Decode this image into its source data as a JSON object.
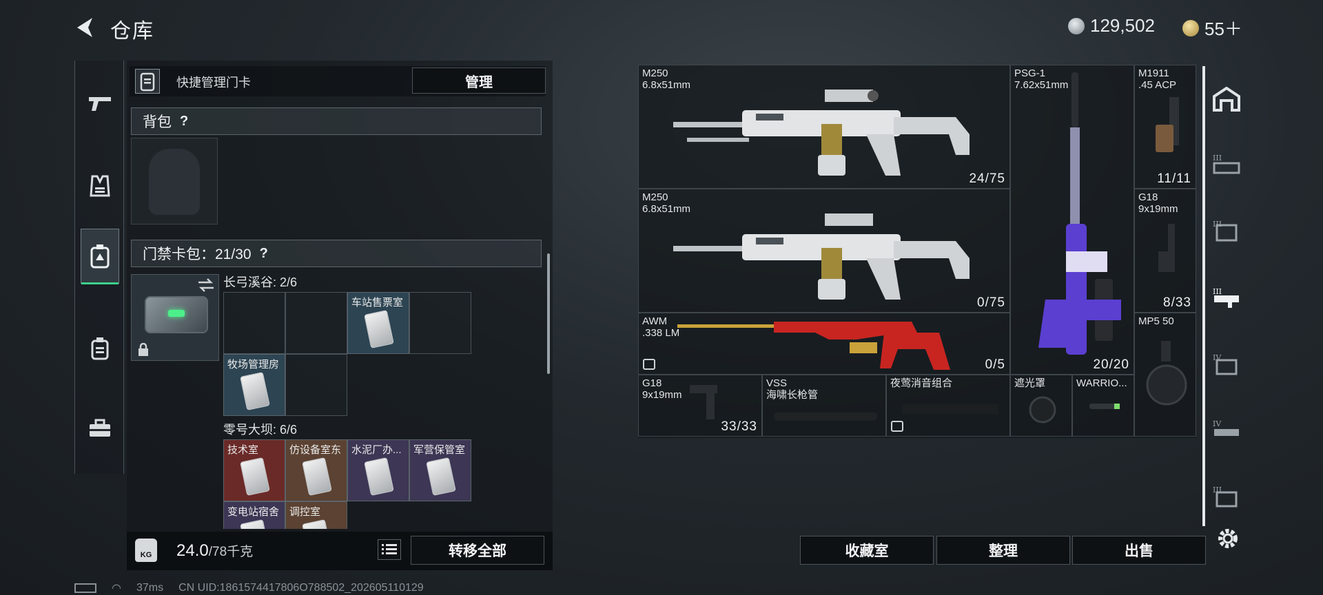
{
  "header": {
    "title": "仓库",
    "currency_silver": "129,502",
    "currency_gold": "55＋"
  },
  "left_tabs": [
    "gun-icon",
    "armor-vest-icon",
    "keycard-case-icon",
    "backpack-icon",
    "toolbox-icon"
  ],
  "left_panel": {
    "quick_manage_label": "快捷管理门卡",
    "manage_button": "管理",
    "backpack_header": "背包",
    "backpack_help": "?",
    "keycard_header": "门禁卡包：21/30",
    "keycard_help": "?",
    "groups": [
      {
        "title": "长弓溪谷: 2/6",
        "cards": [
          {
            "name": "车站售票室"
          },
          {
            "name": "牧场管理房"
          }
        ]
      },
      {
        "title": "零号大坝: 6/6",
        "cards": [
          {
            "name": "技术室"
          },
          {
            "name": "仿设备室东"
          },
          {
            "name": "水泥厂办..."
          },
          {
            "name": "军营保管室"
          },
          {
            "name": "变电站宿舍"
          },
          {
            "name": "调控室"
          }
        ]
      }
    ],
    "weight_current": "24.0",
    "weight_max": "/78千克",
    "transfer_all_button": "转移全部"
  },
  "status": {
    "ping": "37ms",
    "uid": "CN UID:1861574417806O788502_202605110129"
  },
  "stash": {
    "items": [
      {
        "name": "M250",
        "caliber": "6.8x51mm",
        "ammo": "24/75"
      },
      {
        "name": "M250",
        "caliber": "6.8x51mm",
        "ammo": "0/75"
      },
      {
        "name": "AWM",
        "caliber": ".338 LM",
        "ammo": "0/5"
      },
      {
        "name": "PSG-1",
        "caliber": "7.62x51mm",
        "ammo": "20/20"
      },
      {
        "name": "M1911",
        "caliber": ".45 ACP",
        "ammo": "11/11"
      },
      {
        "name": "G18",
        "caliber": "9x19mm",
        "ammo": "8/33"
      },
      {
        "name": "MP5 50",
        "caliber": "",
        "ammo": ""
      },
      {
        "name": "G18",
        "caliber": "9x19mm",
        "ammo": "33/33"
      },
      {
        "name": "VSS",
        "caliber": "海啸长枪管",
        "ammo": ""
      },
      {
        "name": "夜莺消音组合",
        "caliber": "",
        "ammo": ""
      },
      {
        "name": "遮光罩",
        "caliber": "",
        "ammo": ""
      },
      {
        "name": "WARRIO...",
        "caliber": "",
        "ammo": ""
      }
    ]
  },
  "bottom_buttons": {
    "collection": "收藏室",
    "organize": "整理",
    "sell": "出售"
  },
  "right_tabs": [
    "storage-room-icon",
    "shelf-iii-icon",
    "shelf-iii-b-icon",
    "shelf-iii-c-icon",
    "shelf-iv-icon",
    "shelf-iv-b-icon",
    "shelf-v-icon"
  ],
  "colors": {
    "accent_green": "#3bd08a",
    "keycard_red": "#6a2a28",
    "keycard_purple": "#3d3654",
    "keycard_blue": "#2d4452",
    "psg_purple": "#5b3fd1",
    "awm_red": "#c82521"
  }
}
